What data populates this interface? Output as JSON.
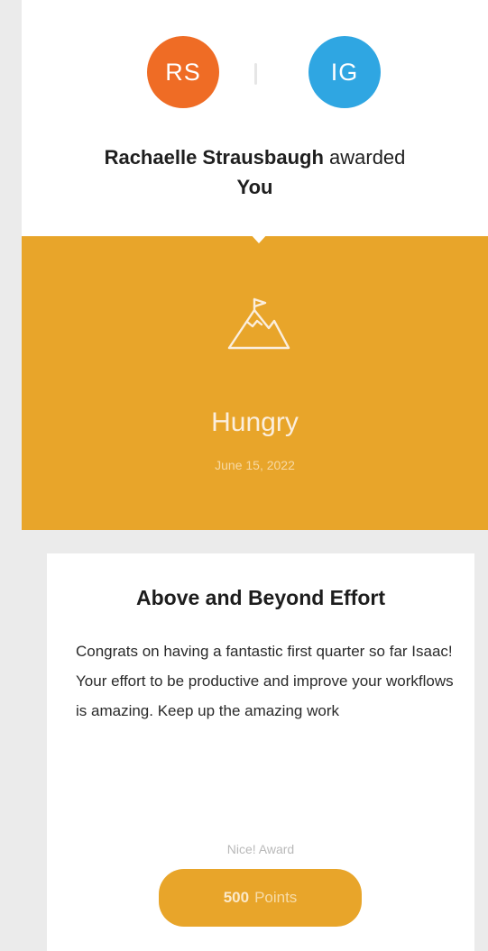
{
  "header": {
    "from_initials": "RS",
    "to_initials": "IG",
    "giver_name": "Rachaelle Strausbaugh",
    "verb": "awarded",
    "recipient": "You"
  },
  "award": {
    "icon": "mountain-flag-icon",
    "name": "Hungry",
    "date": "June 15, 2022"
  },
  "message": {
    "title": "Above and Beyond Effort",
    "body": "Congrats on having a fantastic first quarter so far Isaac! Your effort to be productive and improve your workflows is amazing. Keep up the amazing work",
    "award_type": "Nice! Award",
    "points_value": "500",
    "points_unit": "Points"
  },
  "colors": {
    "from_avatar": "#ef6c25",
    "to_avatar": "#2fa6e2",
    "accent": "#e8a52a"
  }
}
